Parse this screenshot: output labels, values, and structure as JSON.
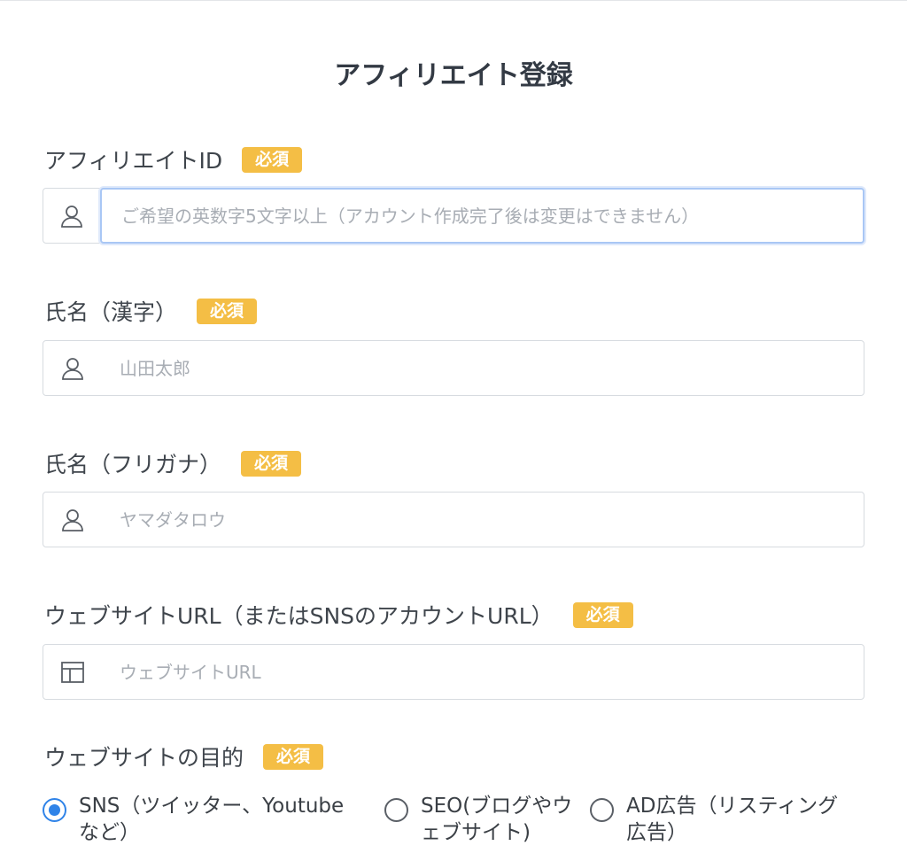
{
  "page": {
    "title": "アフィリエイト登録"
  },
  "required_badge": "必須",
  "fields": {
    "affiliate_id": {
      "label": "アフィリエイトID",
      "placeholder": "ご希望の英数字5文字以上（アカウント作成完了後は変更はできません）",
      "icon": "user-icon"
    },
    "name_kanji": {
      "label": "氏名（漢字）",
      "placeholder": "山田太郎",
      "icon": "user-icon"
    },
    "name_kana": {
      "label": "氏名（フリガナ）",
      "placeholder": "ヤマダタロウ",
      "icon": "user-icon"
    },
    "website_url": {
      "label": "ウェブサイトURL（またはSNSのアカウントURL）",
      "placeholder": "ウェブサイトURL",
      "icon": "layout-icon"
    }
  },
  "purpose": {
    "label": "ウェブサイトの目的",
    "options": [
      {
        "line1": "SNS（ツイッター、Youtube",
        "line2": "など）",
        "checked": true
      },
      {
        "line1": "SEO(ブログやウ",
        "line2": "ェブサイト)",
        "checked": false
      },
      {
        "line1": "AD広告（リスティング",
        "line2": "広告）",
        "checked": false
      }
    ]
  },
  "colors": {
    "accent": "#2f83e8",
    "badge": "#f4be45",
    "focus_border": "#a9c7f5"
  }
}
